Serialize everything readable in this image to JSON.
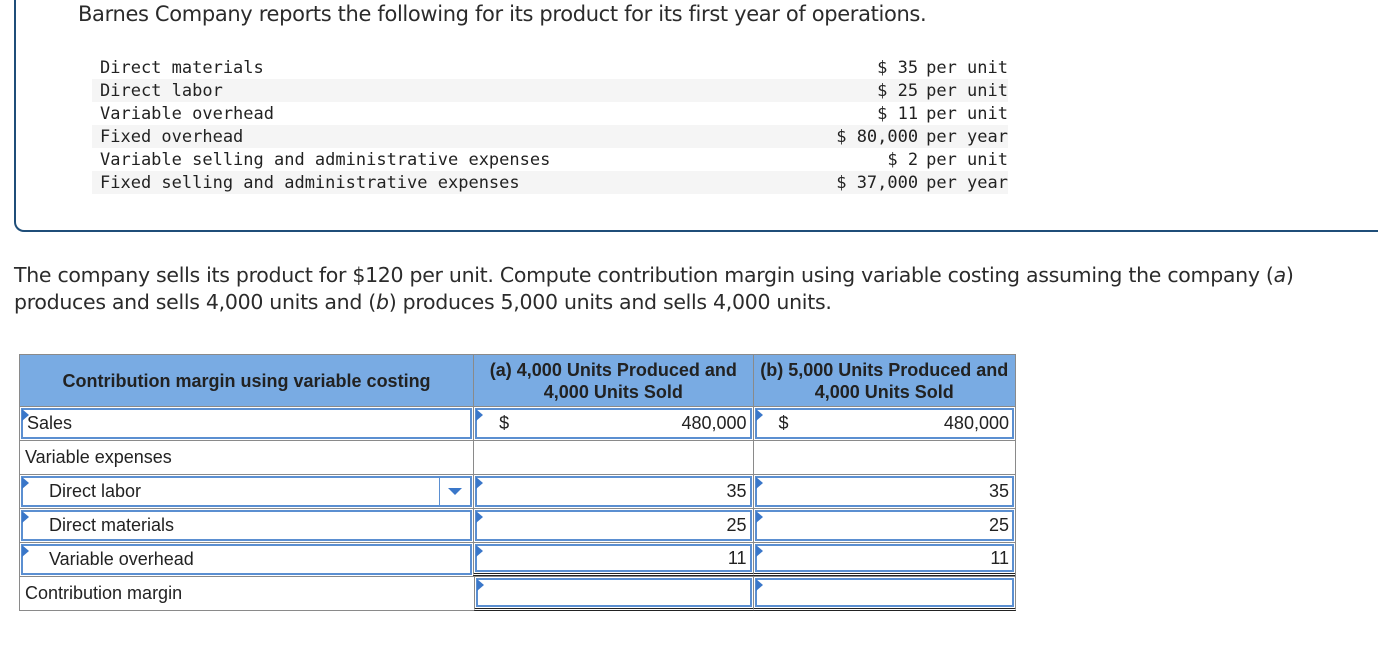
{
  "intro": "Barnes Company reports the following for its product for its first year of operations.",
  "given_items": [
    {
      "label": "Direct materials",
      "amount": "$ 35",
      "basis": "per unit"
    },
    {
      "label": "Direct labor",
      "amount": "$ 25",
      "basis": "per unit"
    },
    {
      "label": "Variable overhead",
      "amount": "$ 11",
      "basis": "per unit"
    },
    {
      "label": "Fixed overhead",
      "amount": "$ 80,000",
      "basis": "per year"
    },
    {
      "label": "Variable selling and administrative expenses",
      "amount": "$ 2",
      "basis": "per unit"
    },
    {
      "label": "Fixed selling and administrative expenses",
      "amount": "$ 37,000",
      "basis": "per year"
    }
  ],
  "question": {
    "part1": "The company sells its product for $120 per unit. Compute contribution margin using variable costing assuming the company (",
    "a": "a",
    "part2": ") produces and sells 4,000 units and (",
    "b": "b",
    "part3": ") produces 5,000 units and sells 4,000 units."
  },
  "table": {
    "headers": [
      "Contribution margin using variable costing",
      "(a) 4,000 Units Produced and 4,000 Units Sold",
      "(b) 5,000 Units Produced and 4,000 Units Sold"
    ],
    "rows": {
      "sales": {
        "label": "Sales",
        "currency_a": "$",
        "value_a": "480,000",
        "currency_b": "$",
        "value_b": "480,000"
      },
      "variable_expenses": {
        "label": "Variable expenses"
      },
      "direct_labor": {
        "label": "Direct labor",
        "value_a": "35",
        "value_b": "35"
      },
      "direct_materials": {
        "label": "Direct materials",
        "value_a": "25",
        "value_b": "25"
      },
      "variable_overhead": {
        "label": "Variable overhead",
        "value_a": "11",
        "value_b": "11"
      },
      "contribution_margin": {
        "label": "Contribution margin",
        "value_a": "",
        "value_b": ""
      }
    }
  },
  "colors": {
    "header_bg": "#79abe3",
    "input_border": "#5b8fd1",
    "box_border": "#1f4e79"
  }
}
